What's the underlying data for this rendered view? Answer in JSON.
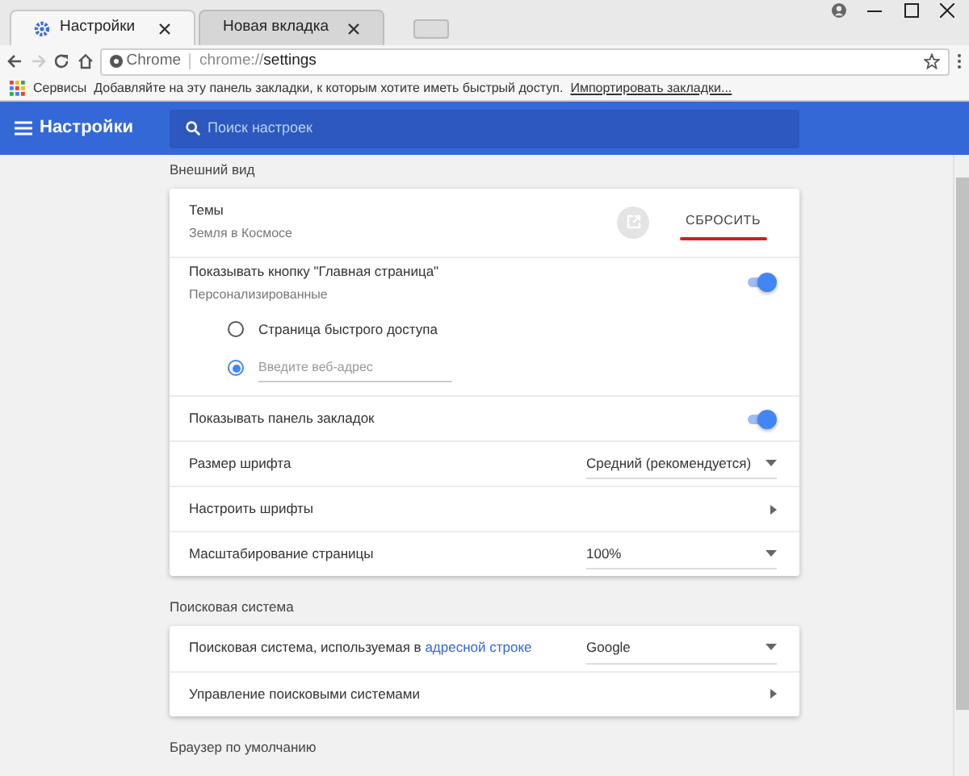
{
  "tabs": [
    {
      "label": "Настройки",
      "selected": true,
      "kind": "settings"
    },
    {
      "label": "Новая вкладка",
      "selected": false,
      "kind": "page"
    }
  ],
  "address_bar": {
    "scheme_label": "Chrome",
    "url_prefix": "chrome://",
    "url_path": "settings"
  },
  "bookmarks_bar": {
    "apps_label": "Сервисы",
    "hint": "Добавляйте на эту панель закладки, к которым хотите иметь быстрый доступ.",
    "import_link": "Импортировать закладки..."
  },
  "header": {
    "title": "Настройки",
    "search_placeholder": "Поиск настроек"
  },
  "sections": [
    {
      "title": "Внешний вид",
      "rows": [
        {
          "kind": "theme",
          "label": "Темы",
          "sublabel": "Земля в Космосе",
          "action": "СБРОСИТЬ"
        },
        {
          "kind": "toggle",
          "label": "Показывать кнопку \"Главная страница\"",
          "sublabel": "Персонализированные",
          "on": true
        },
        {
          "kind": "radio",
          "label": "Страница быстрого доступа",
          "selected": false
        },
        {
          "kind": "radio_input",
          "placeholder": "Введите веб-адрес",
          "selected": true
        },
        {
          "kind": "toggle",
          "label": "Показывать панель закладок",
          "on": true
        },
        {
          "kind": "select",
          "label": "Размер шрифта",
          "value": "Средний (рекомендуется)"
        },
        {
          "kind": "link",
          "label": "Настроить шрифты"
        },
        {
          "kind": "select",
          "label": "Масштабирование страницы",
          "value": "100%"
        }
      ]
    },
    {
      "title": "Поисковая система",
      "rows": [
        {
          "kind": "select",
          "label": "Поисковая система, используемая в",
          "link": "адресной строке",
          "value": "Google"
        },
        {
          "kind": "link",
          "label": "Управление поисковыми системами"
        }
      ]
    },
    {
      "title": "Браузер по умолчанию"
    }
  ]
}
